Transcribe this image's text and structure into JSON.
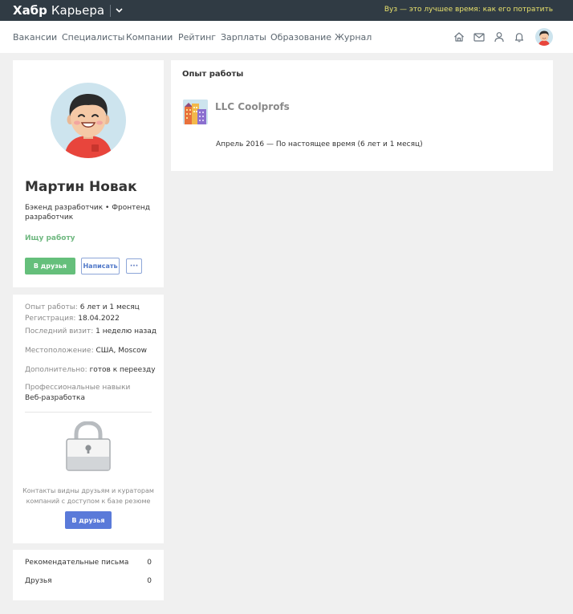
{
  "topbar": {
    "brand_bold": "Хабр",
    "brand_light": "Карьера",
    "promo_link": "Вуз — это лучшее время: как его потратить"
  },
  "nav": {
    "links": [
      "Вакансии",
      "Специалисты",
      "Компании",
      "Рейтинг",
      "Зарплаты",
      "Образование",
      "Журнал"
    ],
    "icons": [
      "home-icon",
      "mail-icon",
      "user-icon",
      "bell-icon"
    ]
  },
  "profile": {
    "name": "Мартин Новак",
    "role": "Бэкенд разработчик • Фронтенд разработчик",
    "status": "Ищу работу",
    "add_friend_label": "В друзья",
    "write_label": "Написать",
    "more_label": "···"
  },
  "info": {
    "experience_label": "Опыт работы:",
    "experience_value": "6 лет и 1 месяц",
    "registration_label": "Регистрация:",
    "registration_value": "18.04.2022",
    "last_visit_label": "Последний визит:",
    "last_visit_value": "1 неделю назад",
    "location_label": "Местоположение:",
    "location_value": "США, Moscow",
    "extra_label": "Дополнительно:",
    "extra_value": "готов к переезду",
    "skills_label": "Профессиональные навыки",
    "skills_value": "Веб-разработка",
    "contacts_note": "Контакты видны друзьям и кураторам компаний с доступом к базе резюме",
    "contacts_button": "В друзья"
  },
  "counters": {
    "items": [
      {
        "label": "Рекомендательные письма",
        "count": "0"
      },
      {
        "label": "Друзья",
        "count": "0"
      }
    ]
  },
  "experience": {
    "title": "Опыт работы",
    "company": "LLC Coolprofs",
    "period": "Апрель 2016 — По настоящее время (6 лет и 1 месяц)"
  },
  "colors": {
    "topbar_bg": "#303b44",
    "promo": "#e9e26c",
    "green": "#65bf7b",
    "blue": "#5a7ad9"
  }
}
